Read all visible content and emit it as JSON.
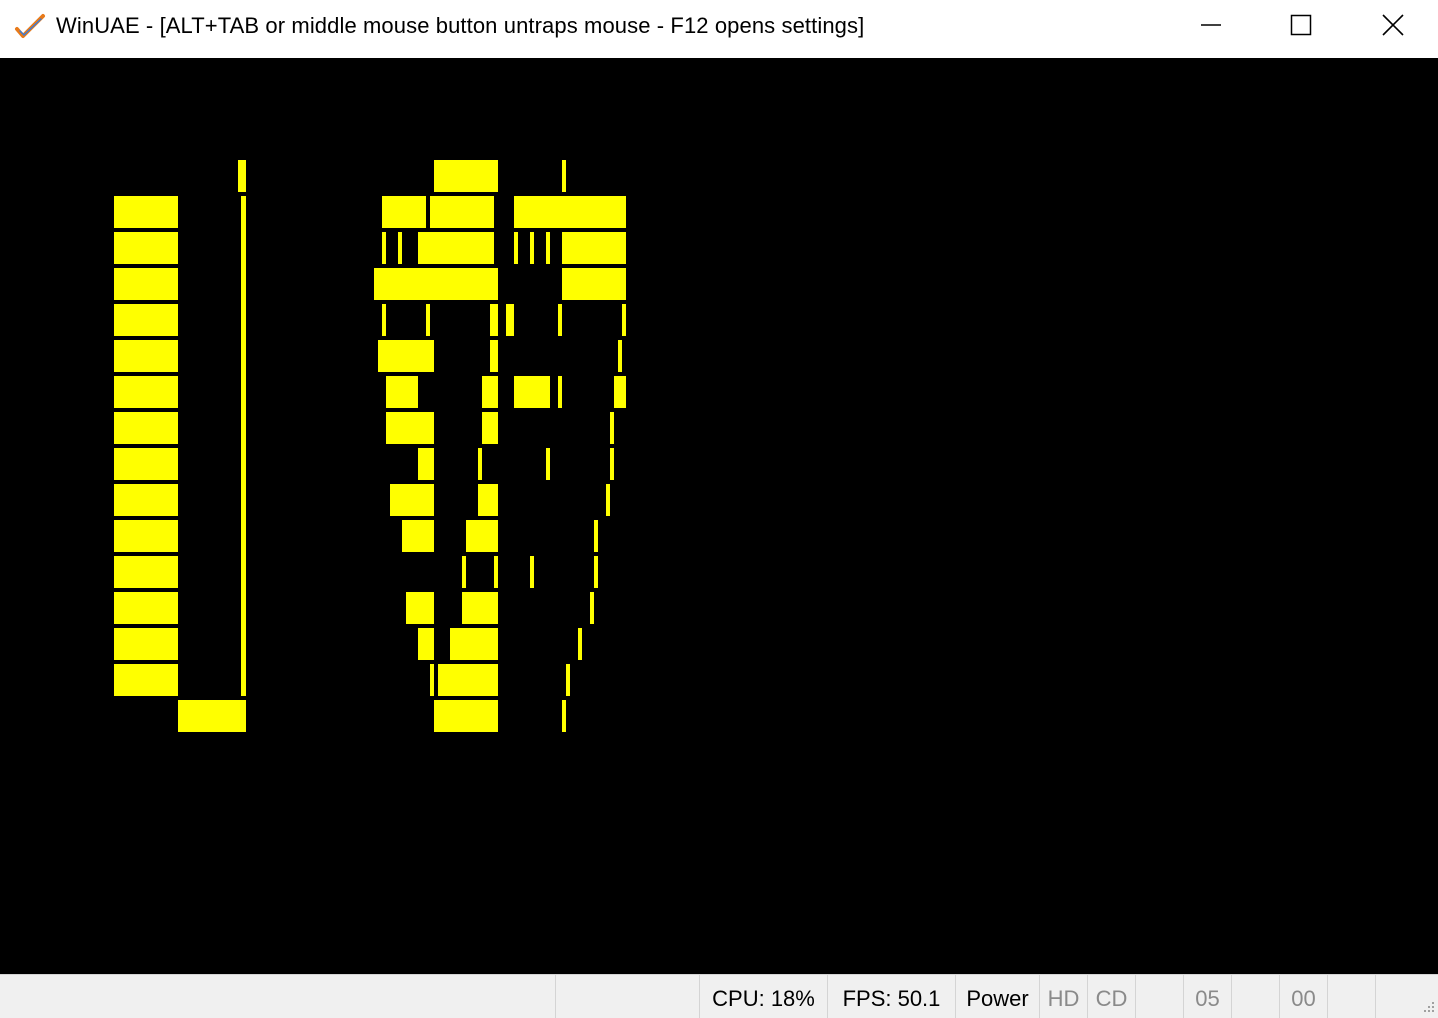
{
  "window": {
    "title": "WinUAE - [ALT+TAB or middle mouse button untraps mouse - F12 opens settings]",
    "icon": "winuae-checkmark-icon",
    "controls": {
      "minimize": "minimize-icon",
      "maximize": "maximize-icon",
      "close": "close-icon"
    }
  },
  "display": {
    "background": "#000000",
    "pattern_color": "#ffff00"
  },
  "statusbar": {
    "segments": [
      {
        "key": "blank1",
        "text": ""
      },
      {
        "key": "blank2",
        "text": ""
      },
      {
        "key": "cpu",
        "text": "CPU: 18%"
      },
      {
        "key": "fps",
        "text": "FPS: 50.1"
      },
      {
        "key": "power",
        "text": "Power"
      },
      {
        "key": "hd",
        "text": "HD"
      },
      {
        "key": "cd",
        "text": "CD"
      },
      {
        "key": "df0",
        "text": ""
      },
      {
        "key": "df0_track",
        "text": "05"
      },
      {
        "key": "df1",
        "text": ""
      },
      {
        "key": "df1_track",
        "text": "00"
      },
      {
        "key": "blank3",
        "text": ""
      }
    ]
  }
}
